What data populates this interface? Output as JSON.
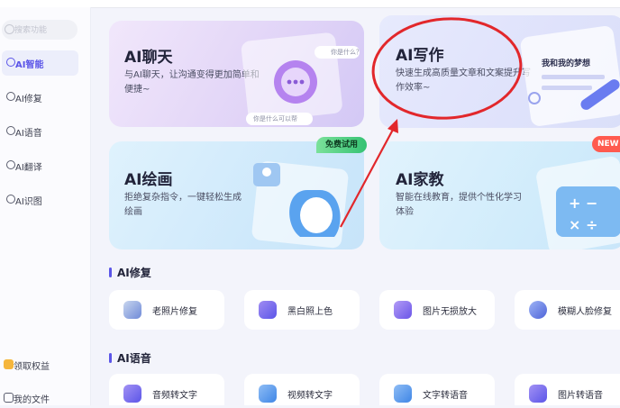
{
  "search": {
    "placeholder": "搜索功能"
  },
  "sidebar": {
    "items": [
      {
        "label": "AI智能",
        "active": true
      },
      {
        "label": "AI修复",
        "active": false
      },
      {
        "label": "AI语音",
        "active": false
      },
      {
        "label": "AI翻译",
        "active": false
      },
      {
        "label": "AI识图",
        "active": false
      }
    ],
    "bottom": [
      {
        "label": "领取权益"
      },
      {
        "label": "我的文件"
      }
    ]
  },
  "cards": {
    "chat": {
      "title": "AI聊天",
      "desc": "与AI聊天，让沟通变得更加简单和便捷~",
      "bubble1": "你是什么？",
      "bubble2": "你是什么可以帮"
    },
    "write": {
      "title": "AI写作",
      "desc": "快速生成高质量文章和文案提升写作效率~",
      "note": "我和我的梦想"
    },
    "draw": {
      "title": "AI绘画",
      "desc": "拒绝复杂指令，一键轻松生成绘画",
      "badge": "免费试用"
    },
    "tutor": {
      "title": "AI家教",
      "desc": "智能在线教育，提供个性化学习体验",
      "badge": "NEW"
    }
  },
  "sections": {
    "repair": {
      "title": "AI修复",
      "tools": [
        {
          "label": "老照片修复",
          "icon": "old-photo-icon"
        },
        {
          "label": "黑白照上色",
          "icon": "colorize-icon"
        },
        {
          "label": "图片无损放大",
          "icon": "upscale-icon"
        },
        {
          "label": "模糊人脸修复",
          "icon": "face-restore-icon"
        }
      ]
    },
    "voice": {
      "title": "AI语音",
      "tools": [
        {
          "label": "音频转文字",
          "icon": "audio-to-text-icon"
        },
        {
          "label": "视频转文字",
          "icon": "video-to-text-icon"
        },
        {
          "label": "文字转语音",
          "icon": "text-to-speech-icon"
        },
        {
          "label": "图片转语音",
          "icon": "image-to-speech-icon"
        }
      ]
    }
  },
  "colors": {
    "accent": "#5b55e8",
    "annotation": "#e2272b",
    "free_badge": "#35c273",
    "new_badge": "#ff5a4f"
  }
}
